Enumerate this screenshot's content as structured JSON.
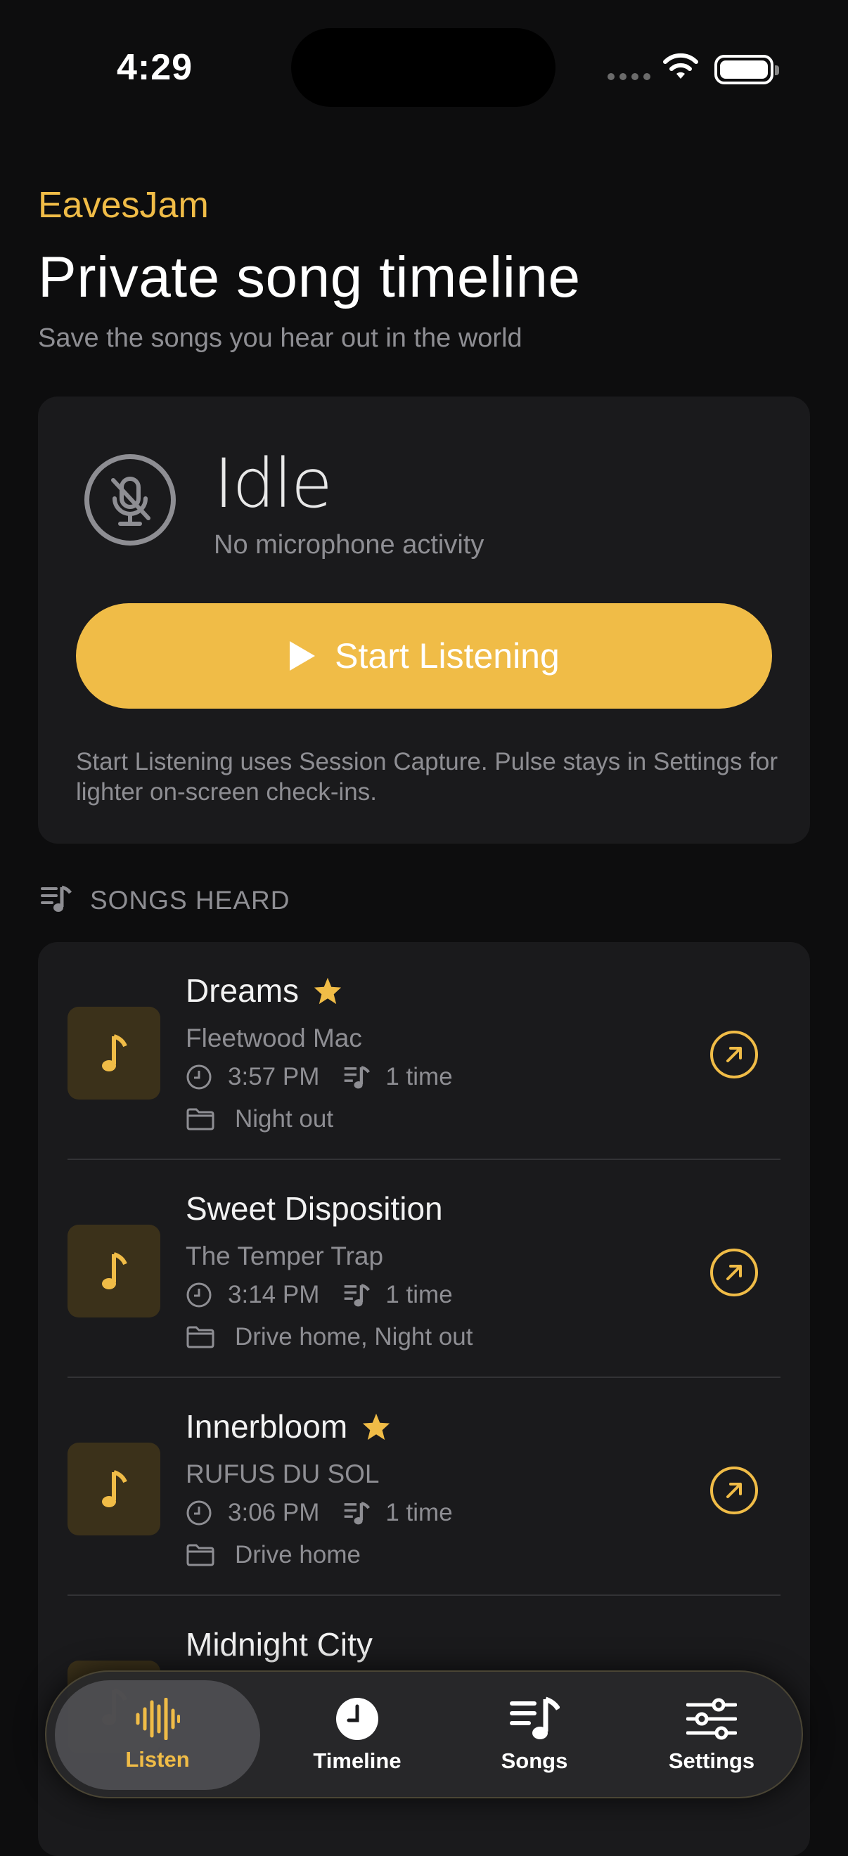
{
  "status_bar": {
    "time": "4:29"
  },
  "header": {
    "brand": "EavesJam",
    "title": "Private song timeline",
    "subtitle": "Save the songs you hear out in the world"
  },
  "listen_card": {
    "state": "Idle",
    "state_detail": "No microphone activity",
    "button_label": "Start Listening",
    "note": "Start Listening uses Session Capture. Pulse stays in Settings for lighter on-screen check-ins."
  },
  "section": {
    "label": "SONGS HEARD"
  },
  "songs": [
    {
      "title": "Dreams",
      "artist": "Fleetwood Mac",
      "time": "3:57 PM",
      "plays": "1 time",
      "folders": "Night out",
      "favorite": true
    },
    {
      "title": "Sweet Disposition",
      "artist": "The Temper Trap",
      "time": "3:14 PM",
      "plays": "1 time",
      "folders": "Drive home, Night out",
      "favorite": false
    },
    {
      "title": "Innerbloom",
      "artist": "RUFUS DU SOL",
      "time": "3:06 PM",
      "plays": "1 time",
      "folders": "Drive home",
      "favorite": true
    },
    {
      "title": "Midnight City",
      "artist": "",
      "time": "",
      "plays": "",
      "folders": "",
      "favorite": false
    }
  ],
  "tabs": [
    {
      "label": "Listen",
      "icon": "waveform-icon",
      "active": true
    },
    {
      "label": "Timeline",
      "icon": "clock-icon",
      "active": false
    },
    {
      "label": "Songs",
      "icon": "music-list-icon",
      "active": false
    },
    {
      "label": "Settings",
      "icon": "sliders-icon",
      "active": false
    }
  ],
  "colors": {
    "accent": "#f0bc47",
    "background": "#0d0d0e",
    "card": "#1a1a1c",
    "muted": "#8e8e93"
  }
}
